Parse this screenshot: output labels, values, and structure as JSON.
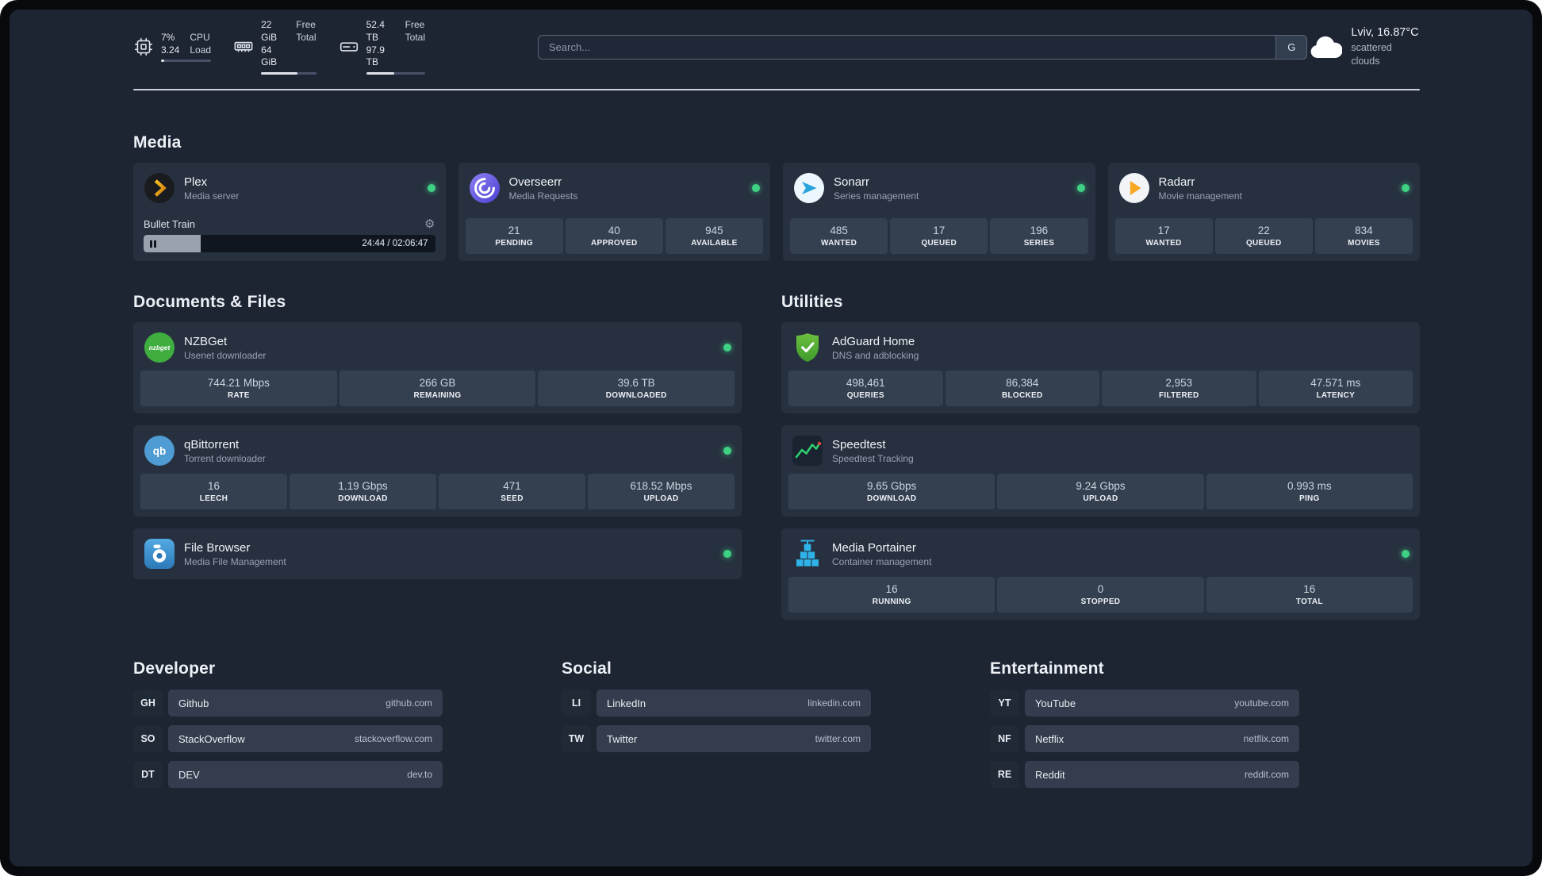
{
  "topbar": {
    "cpu": {
      "value_line1": "7%",
      "value_line2": "3.24",
      "label_line1": "CPU",
      "label_line2": "Load",
      "used_percent": 7
    },
    "memory": {
      "value_line1": "22 GiB",
      "value_line2": "64 GiB",
      "label_line1": "Free",
      "label_line2": "Total",
      "used_percent": 66
    },
    "disk": {
      "value_line1": "52.4 TB",
      "value_line2": "97.9 TB",
      "label_line1": "Free",
      "label_line2": "Total",
      "used_percent": 47
    },
    "search": {
      "placeholder": "Search...",
      "button_label": "G"
    },
    "weather": {
      "location": "Lviv, 16.87°C",
      "condition": "scattered clouds"
    }
  },
  "sections": {
    "media": "Media",
    "documents": "Documents & Files",
    "utilities": "Utilities",
    "developer": "Developer",
    "social": "Social",
    "entertainment": "Entertainment"
  },
  "services": {
    "plex": {
      "name": "Plex",
      "desc": "Media server",
      "media_title": "Bullet Train",
      "time": "24:44 / 02:06:47",
      "progress_percent": 19.5
    },
    "overseerr": {
      "name": "Overseerr",
      "desc": "Media Requests",
      "stats": [
        {
          "value": "21",
          "label": "PENDING"
        },
        {
          "value": "40",
          "label": "APPROVED"
        },
        {
          "value": "945",
          "label": "AVAILABLE"
        }
      ]
    },
    "sonarr": {
      "name": "Sonarr",
      "desc": "Series management",
      "stats": [
        {
          "value": "485",
          "label": "WANTED"
        },
        {
          "value": "17",
          "label": "QUEUED"
        },
        {
          "value": "196",
          "label": "SERIES"
        }
      ]
    },
    "radarr": {
      "name": "Radarr",
      "desc": "Movie management",
      "stats": [
        {
          "value": "17",
          "label": "WANTED"
        },
        {
          "value": "22",
          "label": "QUEUED"
        },
        {
          "value": "834",
          "label": "MOVIES"
        }
      ]
    },
    "nzbget": {
      "name": "NZBGet",
      "desc": "Usenet downloader",
      "stats": [
        {
          "value": "744.21 Mbps",
          "label": "RATE"
        },
        {
          "value": "266 GB",
          "label": "REMAINING"
        },
        {
          "value": "39.6 TB",
          "label": "DOWNLOADED"
        }
      ]
    },
    "qbittorrent": {
      "name": "qBittorrent",
      "desc": "Torrent downloader",
      "stats": [
        {
          "value": "16",
          "label": "LEECH"
        },
        {
          "value": "1.19 Gbps",
          "label": "DOWNLOAD"
        },
        {
          "value": "471",
          "label": "SEED"
        },
        {
          "value": "618.52 Mbps",
          "label": "UPLOAD"
        }
      ]
    },
    "filebrowser": {
      "name": "File Browser",
      "desc": "Media File Management"
    },
    "adguard": {
      "name": "AdGuard Home",
      "desc": "DNS and adblocking",
      "stats": [
        {
          "value": "498,461",
          "label": "QUERIES"
        },
        {
          "value": "86,384",
          "label": "BLOCKED"
        },
        {
          "value": "2,953",
          "label": "FILTERED"
        },
        {
          "value": "47.571 ms",
          "label": "LATENCY"
        }
      ]
    },
    "speedtest": {
      "name": "Speedtest",
      "desc": "Speedtest Tracking",
      "stats": [
        {
          "value": "9.65 Gbps",
          "label": "DOWNLOAD"
        },
        {
          "value": "9.24 Gbps",
          "label": "UPLOAD"
        },
        {
          "value": "0.993 ms",
          "label": "PING"
        }
      ]
    },
    "portainer": {
      "name": "Media Portainer",
      "desc": "Container management",
      "stats": [
        {
          "value": "16",
          "label": "RUNNING"
        },
        {
          "value": "0",
          "label": "STOPPED"
        },
        {
          "value": "16",
          "label": "TOTAL"
        }
      ]
    }
  },
  "bookmarks": {
    "developer": [
      {
        "abbr": "GH",
        "name": "Github",
        "domain": "github.com"
      },
      {
        "abbr": "SO",
        "name": "StackOverflow",
        "domain": "stackoverflow.com"
      },
      {
        "abbr": "DT",
        "name": "DEV",
        "domain": "dev.to"
      }
    ],
    "social": [
      {
        "abbr": "LI",
        "name": "LinkedIn",
        "domain": "linkedin.com"
      },
      {
        "abbr": "TW",
        "name": "Twitter",
        "domain": "twitter.com"
      }
    ],
    "entertainment": [
      {
        "abbr": "YT",
        "name": "YouTube",
        "domain": "youtube.com"
      },
      {
        "abbr": "NF",
        "name": "Netflix",
        "domain": "netflix.com"
      },
      {
        "abbr": "RE",
        "name": "Reddit",
        "domain": "reddit.com"
      }
    ]
  },
  "icons": {
    "gear": "⚙"
  },
  "colors": {
    "status_online": "#3ed183",
    "page_bg": "#1d2533",
    "card_bg": "#27303f",
    "tile_bg": "#344050"
  }
}
